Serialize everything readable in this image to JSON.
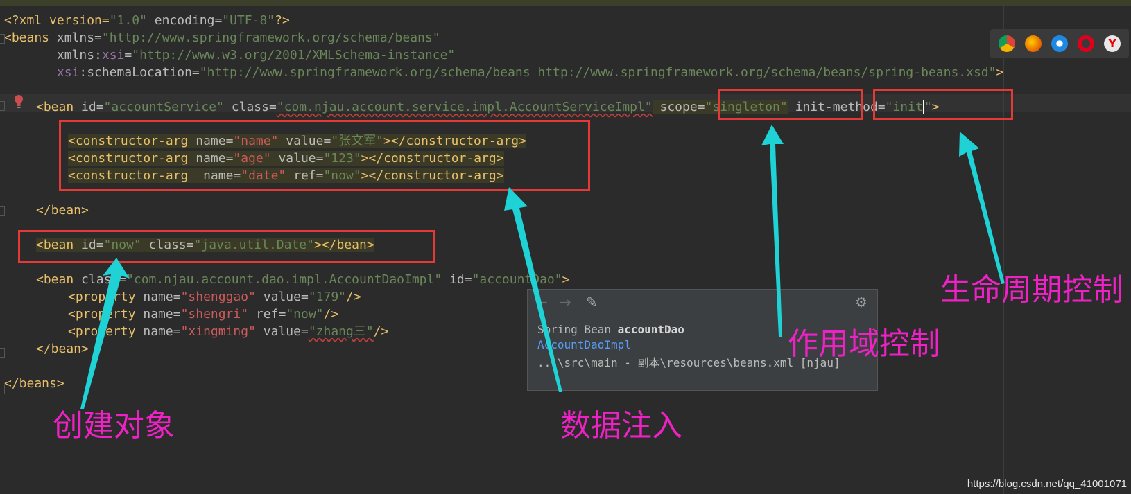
{
  "code_lines": {
    "l1": {
      "a": "<?xml version=",
      "b": "\"1.0\"",
      "c": " encoding=",
      "d": "\"UTF-8\"",
      "e": "?>"
    },
    "l2": {
      "a": "<beans",
      " b": " xmlns=",
      "c": "\"http://www.springframework.org/schema/beans\""
    },
    "l3": {
      "a": "       xmlns:",
      "b": "xsi",
      "c": "=",
      "d": "\"http://www.w3.org/2001/XMLSchema-instance\""
    },
    "l4": {
      "a": "       ",
      "b": "xsi",
      "c": ":schemaLocation=",
      "d": "\"http://www.springframework.org/schema/beans http://www.springframework.org/schema/beans/spring-beans.xsd\"",
      "e": ">"
    },
    "l5": {
      "a": "<bean",
      "b": " id=",
      "c": "\"accountService\"",
      "d": " class=",
      "e": "\"com.njau.account.service.impl.AccountServiceImpl\"",
      "f": " scope=",
      "g": "\"singleton\"",
      "h": " init-method=",
      "i": "\"init",
      "j": "\"",
      "k": ">"
    },
    "l6": {
      "a": "<constructor-arg",
      "b": " name=",
      "c": "\"name\"",
      "d": " value=",
      "e": "\"张文军\"",
      "f": "></constructor-arg>"
    },
    "l7": {
      "a": "<constructor-arg",
      "b": " name=",
      "c": "\"age\"",
      "d": " value=",
      "e": "\"123\"",
      "f": "></constructor-arg>"
    },
    "l8": {
      "a": "<constructor-arg",
      "b": "  name=",
      "c": "\"date\"",
      "d": " ref=",
      "e": "\"now\"",
      "f": "></constructor-arg>"
    },
    "l9": {
      "a": "</bean>"
    },
    "l10": {
      "a": "<bean",
      "b": " id=",
      "c": "\"now\"",
      "d": " class=",
      "e": "\"java.util.Date\"",
      "f": "></bean>"
    },
    "l11": {
      "a": "<bean",
      "b": " class=",
      "c": "\"com.njau.account.dao.impl.AccountDaoImpl\"",
      "d": " id=",
      "e": "\"accountDao\"",
      "f": ">"
    },
    "l12": {
      "a": "<property",
      "b": " name=",
      "c": "\"shenggao\"",
      "d": " value=",
      "e": "\"179\"",
      "f": "/>"
    },
    "l13": {
      "a": "<property",
      "b": " name=",
      "c": "\"shengri\"",
      "d": " ref=",
      "e": "\"now\"",
      "f": "/>"
    },
    "l14": {
      "a": "<property",
      "b": " name=",
      "c": "\"xingming\"",
      "d": " value=",
      "e": "\"zhang三\"",
      "f": "/>"
    },
    "l15": {
      "a": "</bean>"
    },
    "l16": {
      "a": "</beans>"
    }
  },
  "popup": {
    "line1_prefix": "Spring Bean ",
    "line1_bold": "accountDao",
    "line2_link": "AccountDaoImpl",
    "line3": "...\\src\\main - 副本\\resources\\beans.xml [njau]"
  },
  "annotations": {
    "create_object": "创建对象",
    "data_injection": "数据注入",
    "scope_control": "作用域控制",
    "lifecycle_control": "生命周期控制"
  },
  "browser_icons": [
    "chrome-icon",
    "firefox-icon",
    "safari-icon",
    "opera-icon",
    "yandex-icon"
  ],
  "watermark": "https://blog.csdn.net/qq_41001071",
  "colors": {
    "annotation": "#ee22c4",
    "arrow": "#1ed2d6",
    "box": "#e53935"
  }
}
